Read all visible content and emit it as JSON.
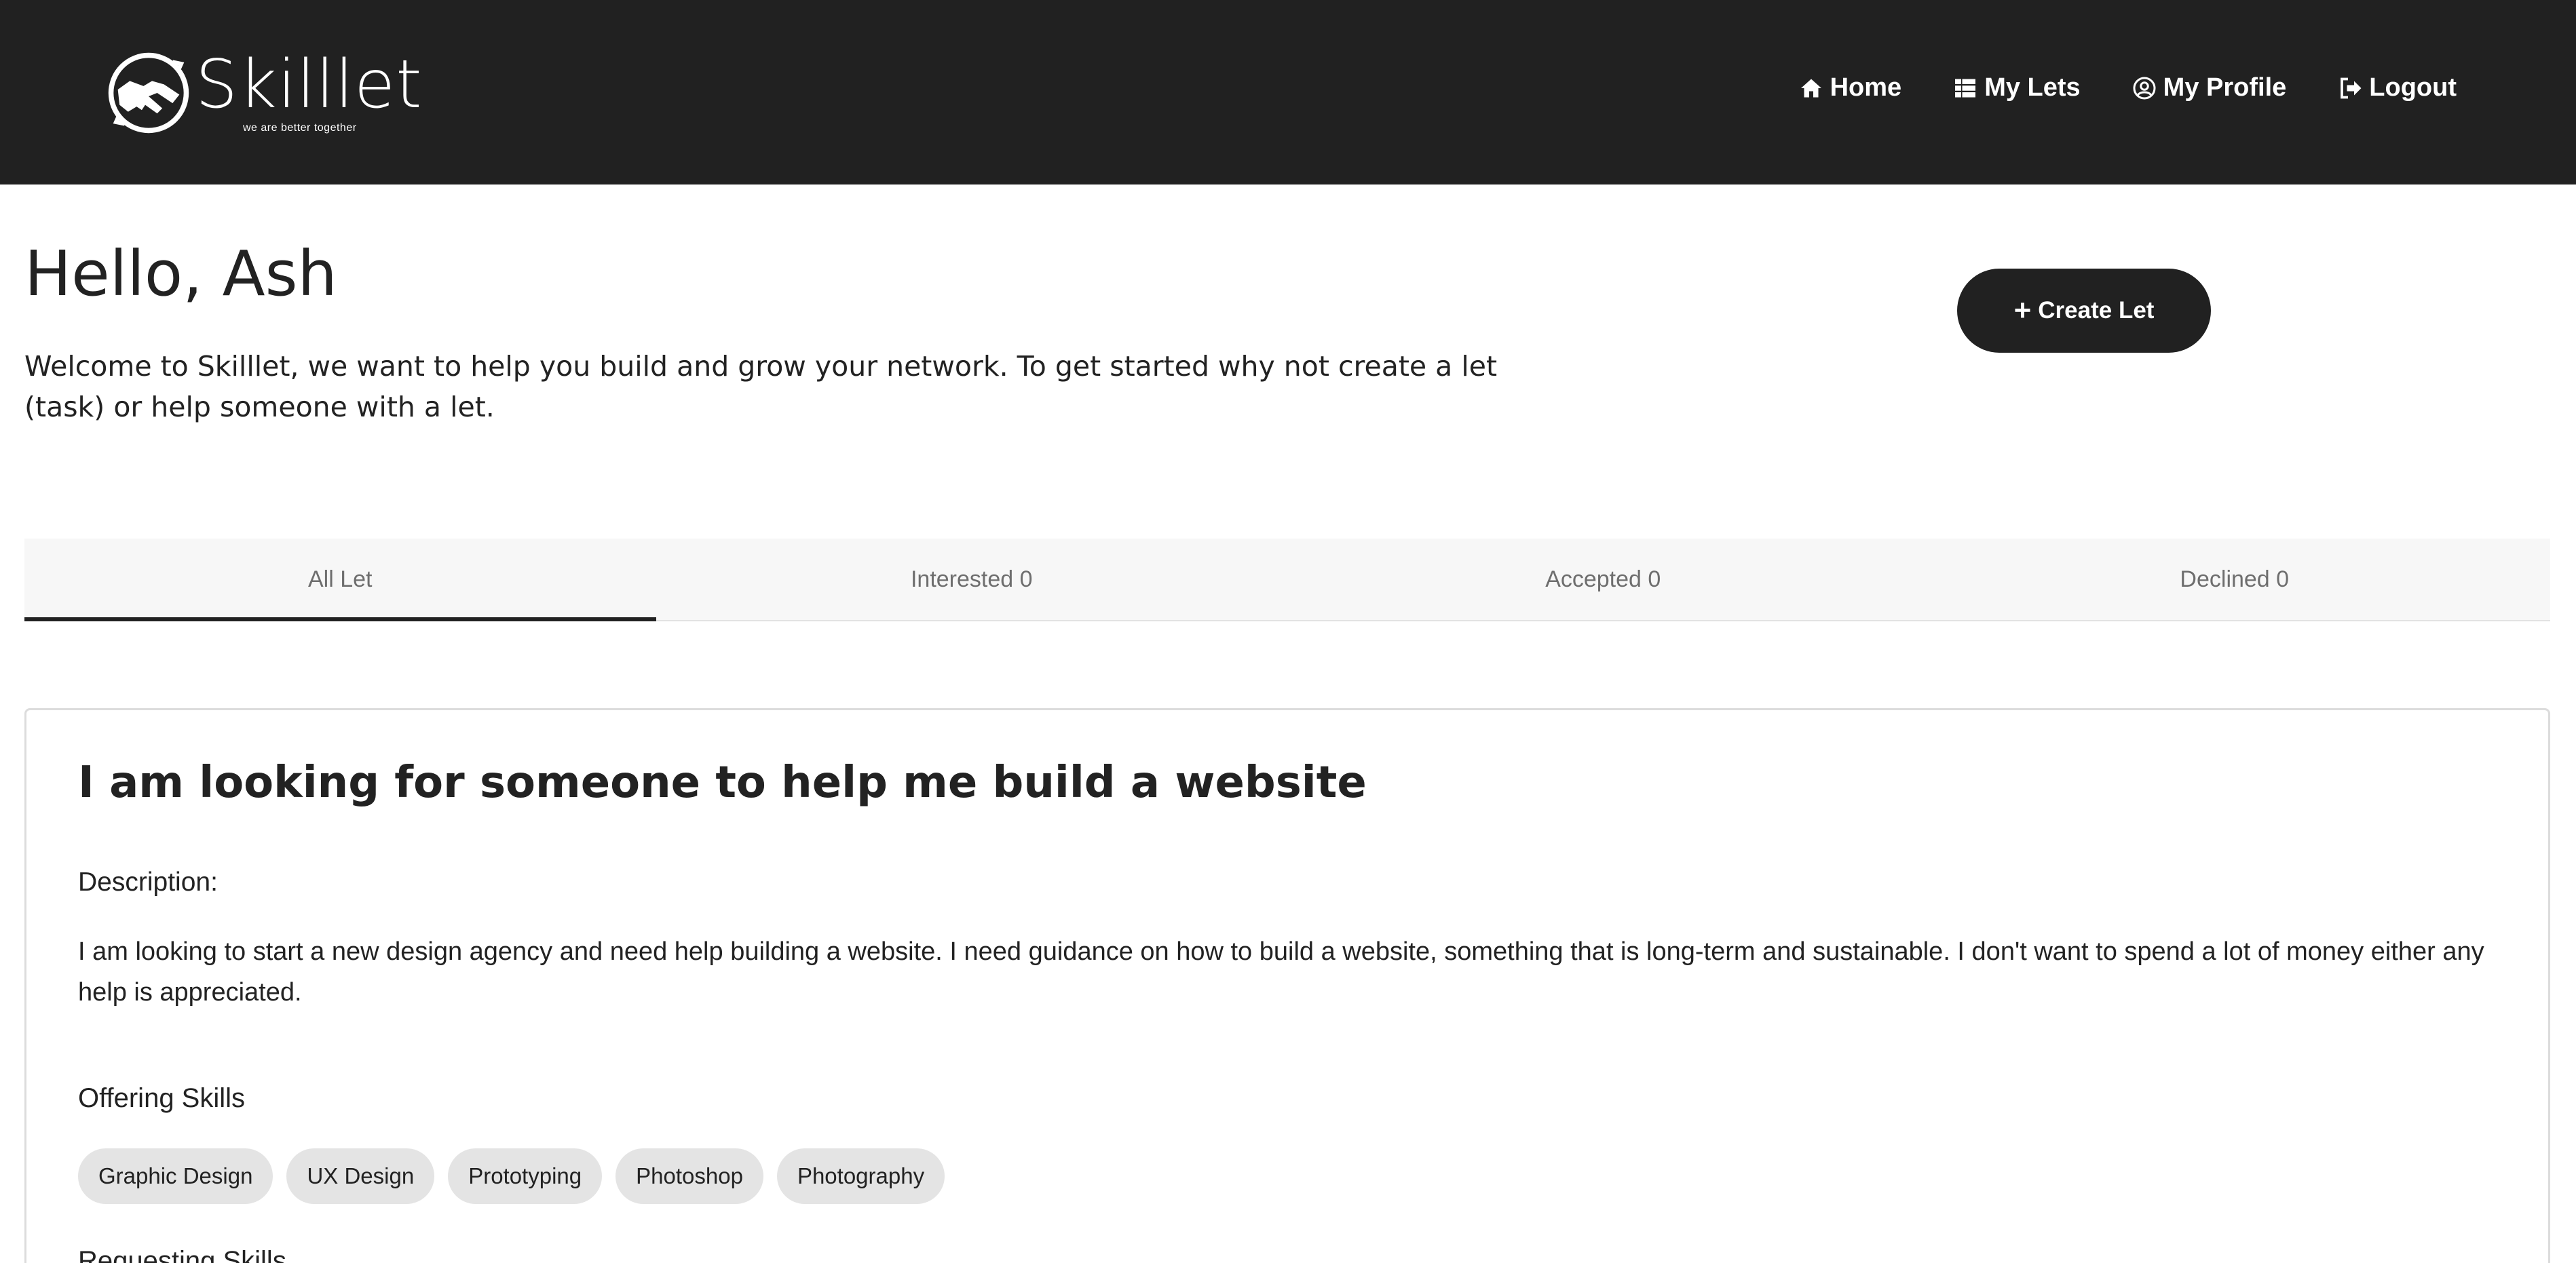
{
  "brand": {
    "name": "Skilllet",
    "tagline": "we are better together",
    "logo_icon": "handshake-circle-icon"
  },
  "nav": {
    "items": [
      {
        "label": "Home",
        "icon": "home-icon"
      },
      {
        "label": "My Lets",
        "icon": "table-icon"
      },
      {
        "label": "My Profile",
        "icon": "user-circle-icon"
      },
      {
        "label": "Logout",
        "icon": "logout-icon"
      }
    ]
  },
  "greeting": {
    "title": "Hello, Ash",
    "welcome": "Welcome to Skilllet, we want to help you build and grow your network. To get started why not create a let (task) or help someone with a let."
  },
  "create_button": {
    "label": "Create Let",
    "icon": "plus-icon"
  },
  "tabs": [
    {
      "label": "All Let",
      "active": true
    },
    {
      "label": "Interested 0",
      "active": false
    },
    {
      "label": "Accepted 0",
      "active": false
    },
    {
      "label": "Declined 0",
      "active": false
    }
  ],
  "let_card": {
    "title": "I am looking for someone to help me build a website",
    "description_label": "Description:",
    "description": "I am looking to start a new design agency and need help building a website. I need guidance on how to build a website, something that is long-term and sustainable. I don't want to spend a lot of money either any help is appreciated.",
    "offering_label": "Offering Skills",
    "offering_skills": [
      "Graphic Design",
      "UX Design",
      "Prototyping",
      "Photoshop",
      "Photography"
    ],
    "requesting_label": "Requesting Skills"
  },
  "colors": {
    "header_bg": "#212121",
    "button_bg": "#212121",
    "chip_bg": "#e4e4e4",
    "tab_bar_bg": "#f7f7f7"
  }
}
